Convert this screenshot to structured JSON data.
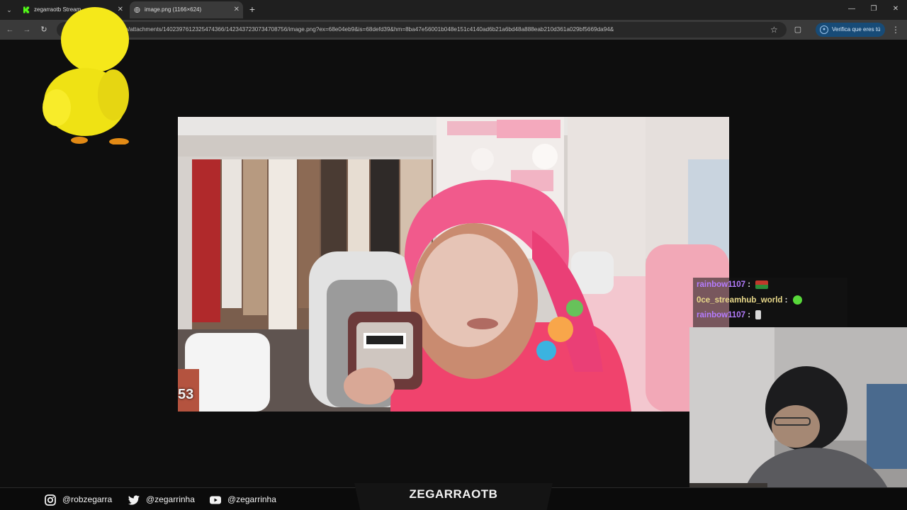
{
  "browser": {
    "tabs": [
      {
        "title": "zegarraotb Stream",
        "active": false,
        "favicon": "kick-logo-icon"
      },
      {
        "title": "image.png (1166×624)",
        "active": true,
        "favicon": "globe-icon"
      }
    ],
    "url": "m/attachments/1402397612325474366/1423437230734708756/image.png?ex=68e04eb9&is=68defd39&hm=8ba47e56001b048e151c4140ad6b21a6bd48a888eab210d361a029bf5669da94&",
    "verify_label": "Verifica que eres tú",
    "icons": {
      "tab_menu": "chevron-down-icon",
      "back": "back-arrow-icon",
      "forward": "forward-arrow-icon",
      "reload": "reload-icon",
      "bookmark": "star-icon",
      "extensions": "puzzle-icon",
      "menu": "kebab-menu-icon"
    }
  },
  "stream": {
    "timer": "53",
    "chat": [
      {
        "user": "rainbow1107",
        "separator": ":",
        "emote": "flag-emote"
      },
      {
        "user": "0ce_streamhub_world",
        "separator": ":",
        "emote": "green-blob-emote"
      },
      {
        "user": "rainbow1107",
        "separator": ":",
        "emote": "hand-emote"
      }
    ]
  },
  "footer": {
    "instagram": "@robzegarra",
    "twitter": "@zegarrinha",
    "youtube": "@zegarrinha",
    "channel": "ZEGARRAOTB"
  },
  "colors": {
    "kick_green": "#53fc18",
    "chat_purple": "#b57cff",
    "verify_bg": "#174b77"
  }
}
